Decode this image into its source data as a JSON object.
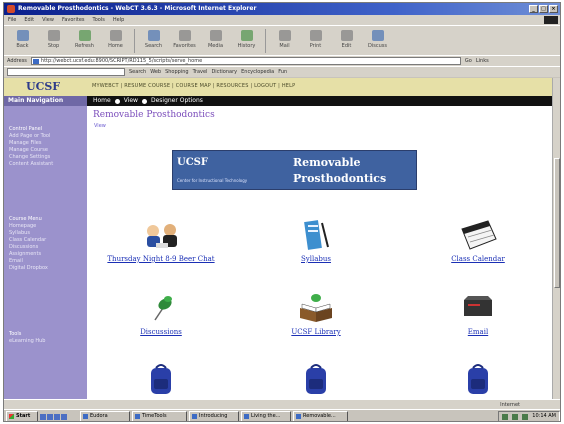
{
  "window": {
    "title": "Removable Prosthodontics - WebCT 3.6.3 - Microsoft Internet Explorer"
  },
  "menu": [
    "File",
    "Edit",
    "View",
    "Favorites",
    "Tools",
    "Help"
  ],
  "toolbar": [
    {
      "label": "Back",
      "icon": "back-arrow-icon"
    },
    {
      "label": "Stop",
      "icon": "stop-icon"
    },
    {
      "label": "Refresh",
      "icon": "refresh-icon"
    },
    {
      "label": "Home",
      "icon": "home-icon"
    },
    {
      "label": "Search",
      "icon": "search-icon"
    },
    {
      "label": "Favorites",
      "icon": "favorites-icon"
    },
    {
      "label": "Media",
      "icon": "media-icon"
    },
    {
      "label": "History",
      "icon": "history-icon"
    },
    {
      "label": "Mail",
      "icon": "mail-icon"
    },
    {
      "label": "Print",
      "icon": "print-icon"
    },
    {
      "label": "Edit",
      "icon": "edit-icon"
    },
    {
      "label": "Discuss",
      "icon": "discuss-icon"
    }
  ],
  "address": {
    "label": "Address",
    "url": "http://webct.ucsf.edu:8900/SCRIPT/RD115_5/scripts/serve_home",
    "go": "Go",
    "links": "Links"
  },
  "links_bar": {
    "search_label": "Search",
    "items": [
      "Web",
      "Shopping",
      "Travel",
      "Dictionary",
      "Encyclopedia",
      "Fun"
    ]
  },
  "webct": {
    "logo": "UCSF",
    "top_nav": "MYWEBCT | RESUME COURSE | COURSE MAP | RESOURCES | LOGOUT | HELP",
    "nav_title": "Main Navigation",
    "breadcrumb": [
      "Home",
      "View",
      "Designer Options"
    ],
    "sidebar_sections": [
      {
        "heading": "Control Panel",
        "items": [
          "Add Page or Tool",
          "Manage Files",
          "Manage Course",
          "Change Settings",
          "Content Assistant"
        ]
      },
      {
        "heading": "Course Menu",
        "items": [
          "Homepage",
          "Syllabus",
          "Class Calendar",
          "Discussions",
          "Assignments",
          "Email",
          "Digital Dropbox"
        ]
      },
      {
        "heading": "Tools",
        "items": [
          "eLearning Hub"
        ]
      }
    ],
    "course_title": "Removable Prosthodontics",
    "course_sub": "View",
    "banner": {
      "logo": "UCSF",
      "center": "Center for Instructional Technology",
      "name_line1": "Removable",
      "name_line2": "Prosthodontics"
    }
  },
  "tools": [
    {
      "label": "Thursday Night 8-9 Beer Chat",
      "icon": "people-chat-icon"
    },
    {
      "label": "Syllabus",
      "icon": "syllabus-pen-icon"
    },
    {
      "label": "Class Calendar",
      "icon": "calendar-icon"
    },
    {
      "label": "Discussions",
      "icon": "pushpin-icon"
    },
    {
      "label": "UCSF Library",
      "icon": "open-book-icon"
    },
    {
      "label": "Email",
      "icon": "mail-box-icon"
    },
    {
      "label": "",
      "icon": "backpack-icon"
    },
    {
      "label": "",
      "icon": "backpack-icon"
    },
    {
      "label": "",
      "icon": "backpack-icon"
    }
  ],
  "status": {
    "zone": "Internet"
  },
  "taskbar": {
    "start": "Start",
    "tasks": [
      "Eudora",
      "TimeTools",
      "Introducing",
      "Living the...",
      "Removable..."
    ],
    "clock": "10:14 AM"
  }
}
